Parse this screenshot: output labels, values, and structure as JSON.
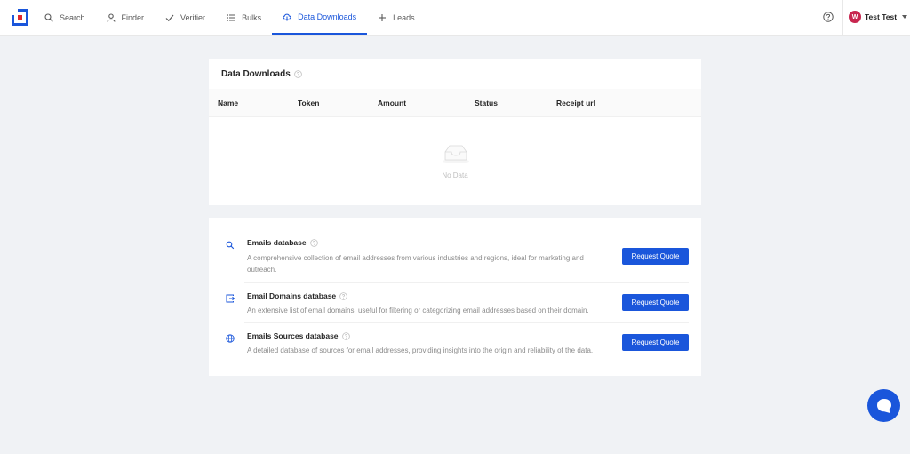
{
  "nav": {
    "items": [
      {
        "label": "Search",
        "icon": "search-icon"
      },
      {
        "label": "Finder",
        "icon": "user-icon"
      },
      {
        "label": "Verifier",
        "icon": "check-icon"
      },
      {
        "label": "Bulks",
        "icon": "list-icon"
      },
      {
        "label": "Data Downloads",
        "icon": "cloud-download-icon",
        "active": true
      },
      {
        "label": "Leads",
        "icon": "plus-icon"
      }
    ]
  },
  "user": {
    "initial": "W",
    "name": "Test Test"
  },
  "downloads": {
    "title": "Data Downloads",
    "columns": [
      "Name",
      "Token",
      "Amount",
      "Status",
      "Receipt url"
    ],
    "empty_text": "No Data"
  },
  "databases": [
    {
      "title": "Emails database",
      "icon": "search-icon",
      "description": "A comprehensive collection of email addresses from various industries and regions, ideal for marketing and outreach.",
      "button": "Request Quote"
    },
    {
      "title": "Email Domains database",
      "icon": "domain-icon",
      "description": "An extensive list of email domains, useful for filtering or categorizing email addresses based on their domain.",
      "button": "Request Quote"
    },
    {
      "title": "Emails Sources database",
      "icon": "globe-icon",
      "description": "A detailed database of sources for email addresses, providing insights into the origin and reliability of the data.",
      "button": "Request Quote"
    }
  ],
  "colors": {
    "accent": "#1a56db",
    "avatar": "#c8264f",
    "background": "#f0f2f5"
  }
}
